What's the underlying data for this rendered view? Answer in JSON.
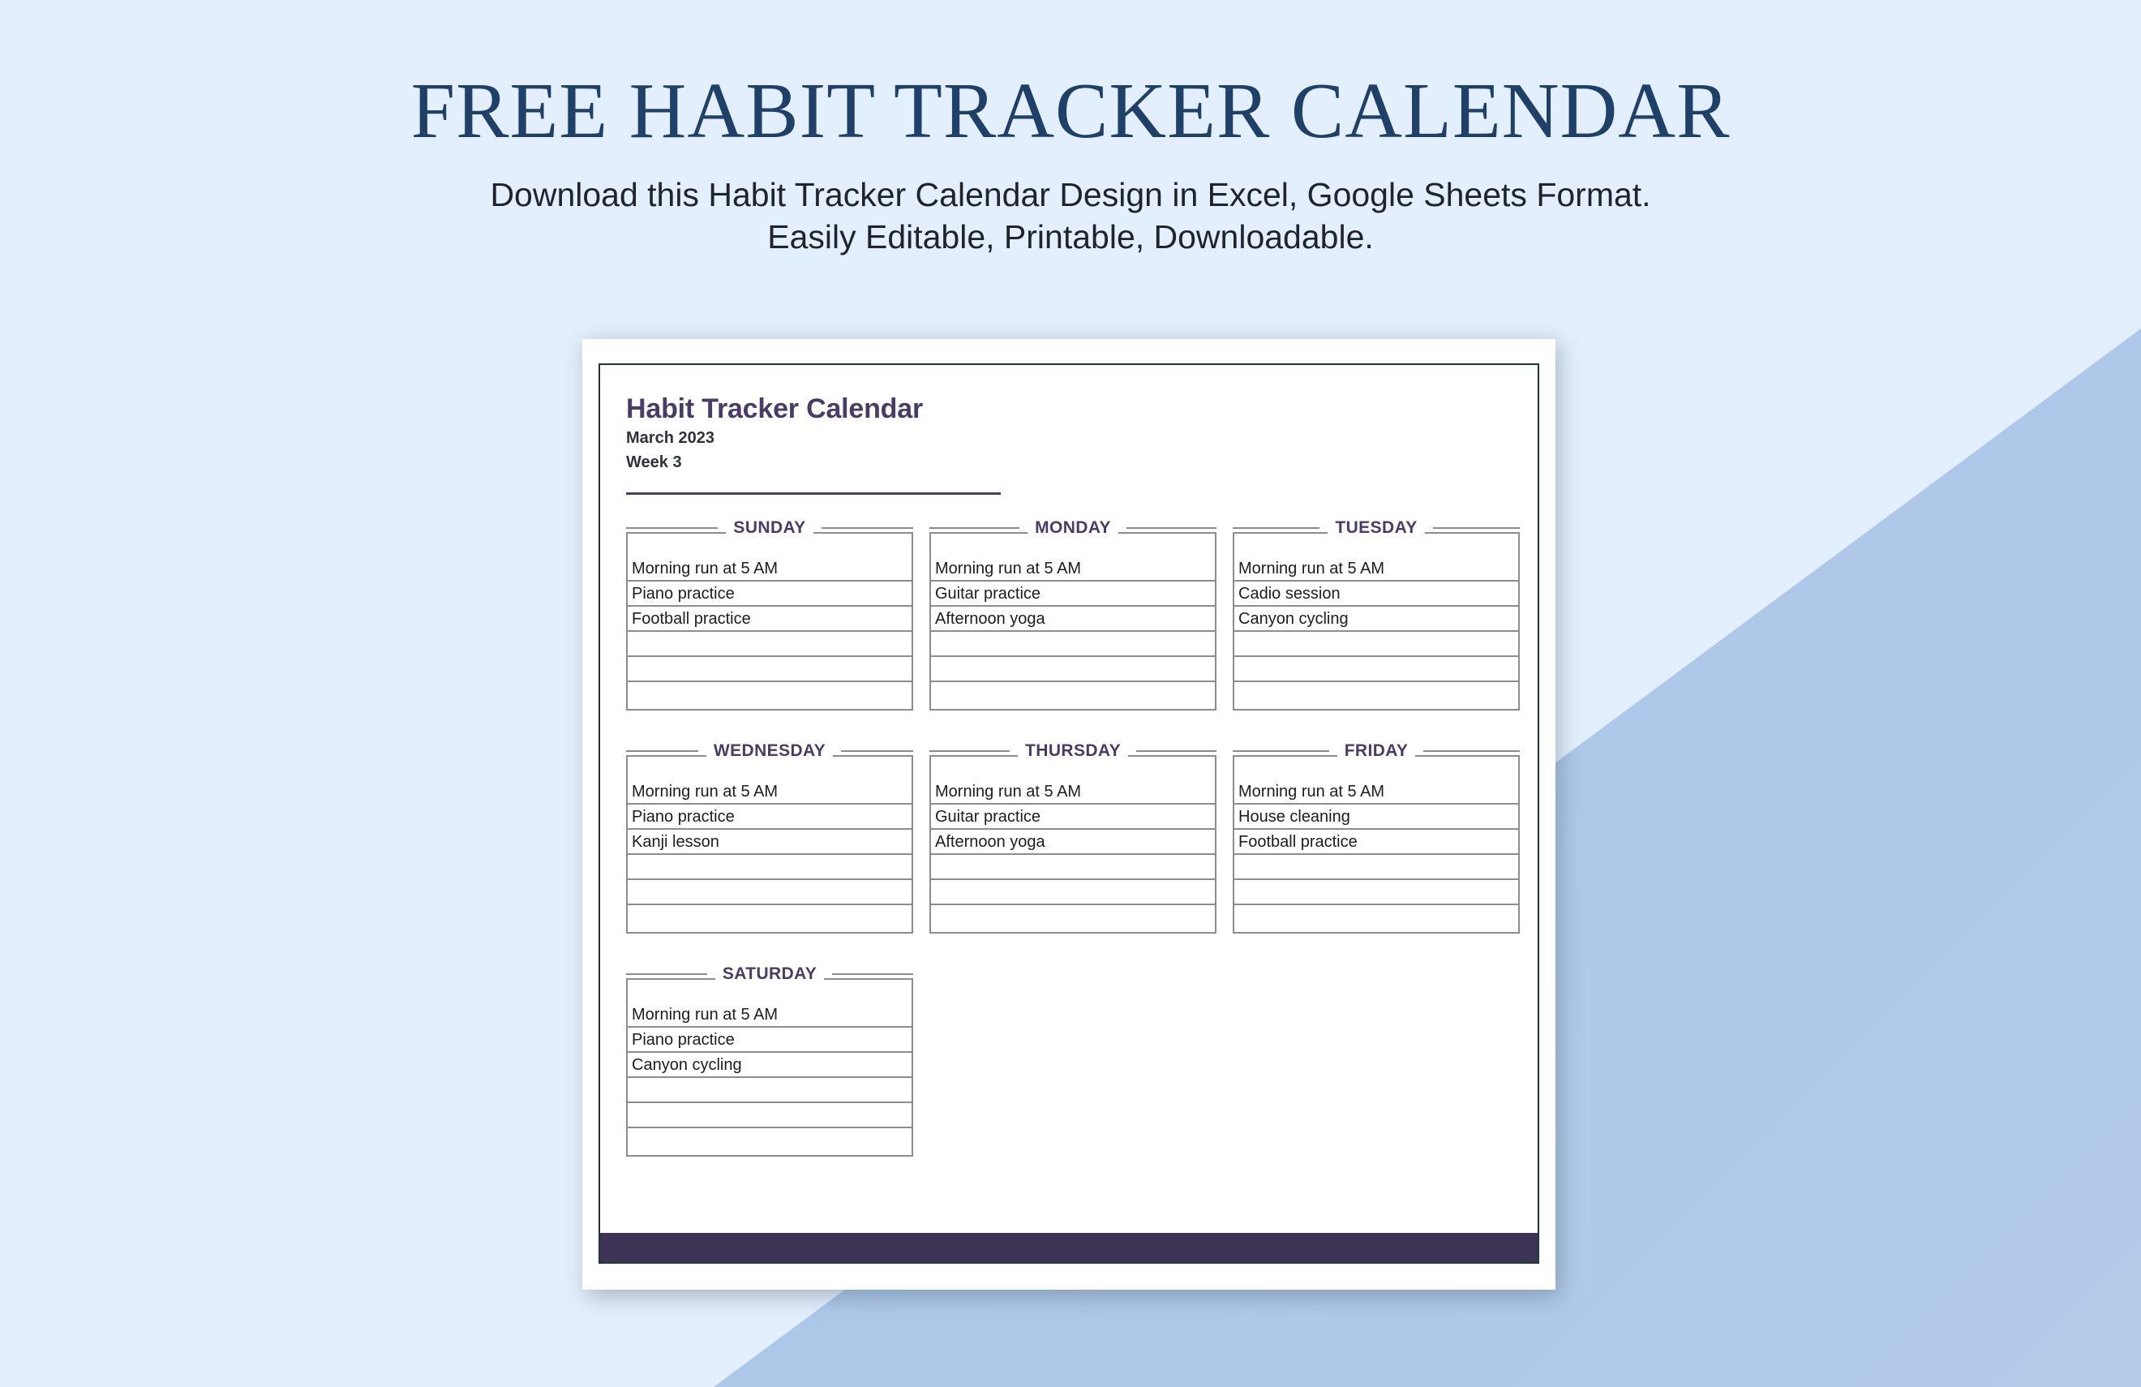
{
  "promo": {
    "headline": "FREE HABIT TRACKER CALENDAR",
    "subline_1": "Download this Habit Tracker Calendar Design in Excel, Google Sheets Format.",
    "subline_2": "Easily Editable, Printable, Downloadable."
  },
  "colors": {
    "page_background": "#e3effc",
    "diagonal_accent": "#abc6e8",
    "headline": "#1f4068",
    "doc_title": "#4a3c66",
    "footer_bar": "#3d3354",
    "page_border": "#1d3a35",
    "table_border": "#8d8d8d"
  },
  "document": {
    "title": "Habit Tracker Calendar",
    "month": "March 2023",
    "week": "Week 3",
    "days": [
      {
        "name": "SUNDAY",
        "entries": [
          "Morning run at 5 AM",
          "Piano practice",
          "Football practice",
          "",
          "",
          ""
        ]
      },
      {
        "name": "MONDAY",
        "entries": [
          "Morning run at 5 AM",
          "Guitar practice",
          "Afternoon yoga",
          "",
          "",
          ""
        ]
      },
      {
        "name": "TUESDAY",
        "entries": [
          "Morning run at 5 AM",
          "Cadio session",
          "Canyon cycling",
          "",
          "",
          ""
        ]
      },
      {
        "name": "WEDNESDAY",
        "entries": [
          "Morning run at 5 AM",
          "Piano practice",
          "Kanji lesson",
          "",
          "",
          ""
        ]
      },
      {
        "name": "THURSDAY",
        "entries": [
          "Morning run at 5 AM",
          "Guitar practice",
          "Afternoon yoga",
          "",
          "",
          ""
        ]
      },
      {
        "name": "FRIDAY",
        "entries": [
          "Morning run at 5 AM",
          "House cleaning",
          "Football practice",
          "",
          "",
          ""
        ]
      },
      {
        "name": "SATURDAY",
        "entries": [
          "Morning run at 5 AM",
          "Piano practice",
          "Canyon cycling",
          "",
          "",
          ""
        ]
      }
    ]
  }
}
